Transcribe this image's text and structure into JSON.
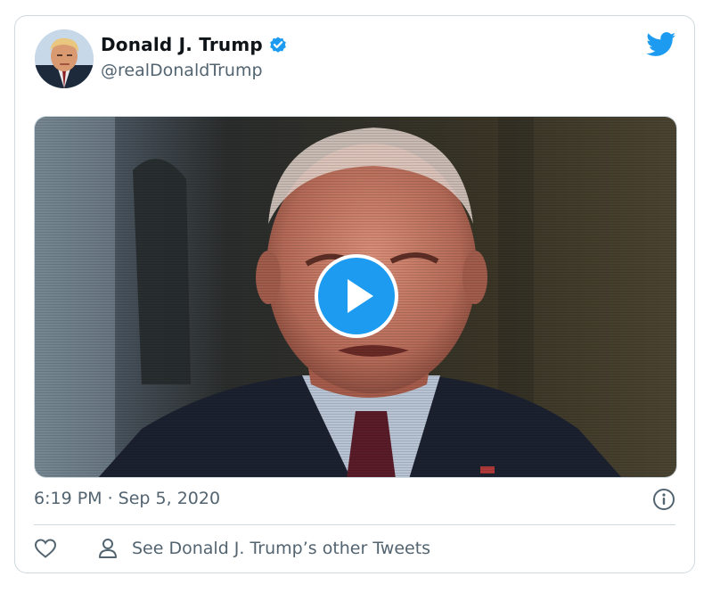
{
  "tweet": {
    "author_name": "Donald J. Trump",
    "author_handle": "@realDonaldTrump",
    "timestamp": "6:19 PM · Sep 5, 2020",
    "other_tweets_link": "See Donald J. Trump’s other Tweets"
  },
  "icons": {
    "brand": "twitter-bird-icon",
    "verified": "verified-badge-icon",
    "play": "play-icon",
    "info": "info-icon",
    "like": "heart-icon",
    "profile": "person-icon"
  },
  "colors": {
    "accent": "#1d9bf0",
    "text_primary": "#0f1419",
    "text_secondary": "#536471",
    "border": "#cfd9de"
  }
}
